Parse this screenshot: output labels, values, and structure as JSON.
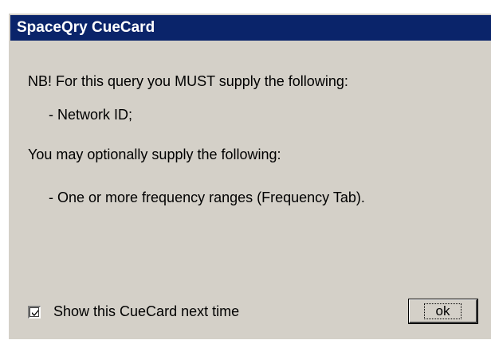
{
  "window": {
    "title": "SpaceQry CueCard"
  },
  "message": {
    "required_intro": "NB! For this query you MUST supply the following:",
    "required_item": "- Network ID;",
    "optional_intro": "You may optionally supply the following:",
    "optional_item": "- One or more frequency ranges (Frequency Tab)."
  },
  "footer": {
    "checkbox_label": "Show this CueCard next time",
    "checkbox_checked": true,
    "ok_label": "ok"
  }
}
